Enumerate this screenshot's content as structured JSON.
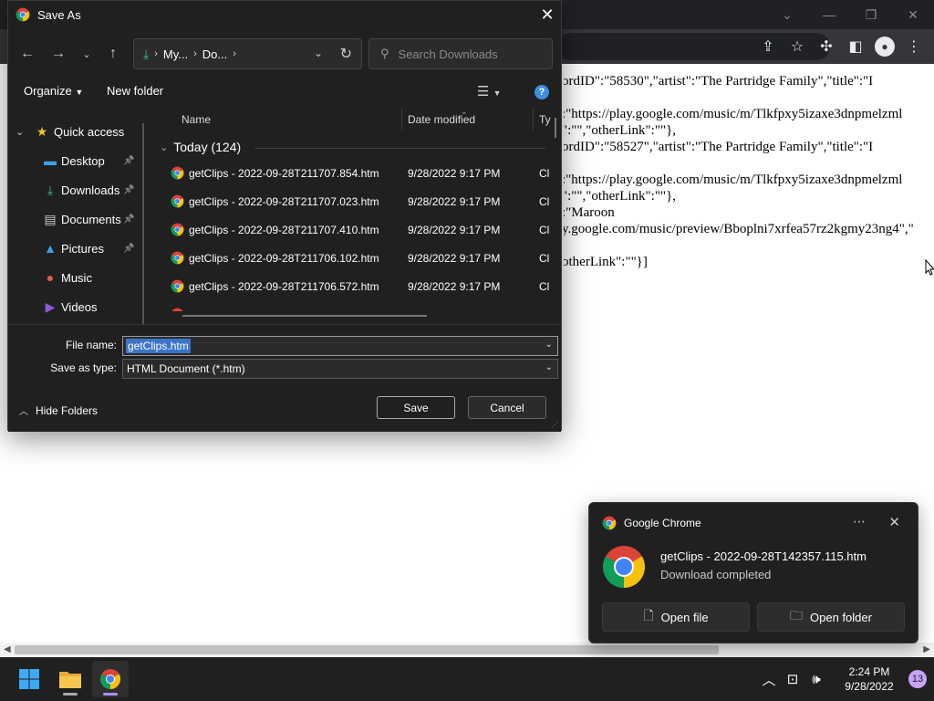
{
  "page": {
    "json_lines": [
      "ordID\":\"58530\",\"artist\":\"The Partridge Family\",\"title\":\"I",
      "",
      ":\"https://play.google.com/music/m/Tlkfpxy5izaxe3dnpmelzml",
      "\":\"\",\"otherLink\":\"\"},",
      "ordID\":\"58527\",\"artist\":\"The Partridge Family\",\"title\":\"I",
      "",
      ":\"https://play.google.com/music/m/Tlkfpxy5izaxe3dnpmelzml",
      "\":\"\",\"otherLink\":\"\"},",
      ":\"Maroon",
      "y.google.com/music/preview/Bboplni7xrfea57rz2kgmy23ng4\",\"",
      "",
      "otherLink\":\"\"}]"
    ]
  },
  "dialog": {
    "title": "Save As",
    "path_segments": [
      "My...",
      "Do..."
    ],
    "search_placeholder": "Search Downloads",
    "organize_label": "Organize",
    "new_folder_label": "New folder",
    "help_label": "?",
    "nav_items": [
      {
        "label": "Quick access",
        "icon": "star-icon",
        "icon_glyph": "★",
        "icon_color": "#f2c12e",
        "pinned": false,
        "quick": true
      },
      {
        "label": "Desktop",
        "icon": "desktop-icon",
        "icon_glyph": "▬",
        "icon_color": "#3aa0e8",
        "pinned": true,
        "quick": false
      },
      {
        "label": "Downloads",
        "icon": "download-icon",
        "icon_glyph": "⤓",
        "icon_color": "#3ec47b",
        "pinned": true,
        "quick": false
      },
      {
        "label": "Documents",
        "icon": "document-icon",
        "icon_glyph": "▤",
        "icon_color": "#c8ccd2",
        "pinned": true,
        "quick": false
      },
      {
        "label": "Pictures",
        "icon": "pictures-icon",
        "icon_glyph": "▲",
        "icon_color": "#3aa0e8",
        "pinned": true,
        "quick": false
      },
      {
        "label": "Music",
        "icon": "music-icon",
        "icon_glyph": "●",
        "icon_color": "#e85c4a",
        "pinned": false,
        "quick": false
      },
      {
        "label": "Videos",
        "icon": "videos-icon",
        "icon_glyph": "▶",
        "icon_color": "#8c5ad8",
        "pinned": false,
        "quick": false
      }
    ],
    "columns": {
      "name": "Name",
      "date": "Date modified",
      "type": "Ty"
    },
    "group_label": "Today (124)",
    "files": [
      {
        "name": "getClips - 2022-09-28T211707.854.htm",
        "date": "9/28/2022 9:17 PM",
        "type": "Cl"
      },
      {
        "name": "getClips - 2022-09-28T211707.023.htm",
        "date": "9/28/2022 9:17 PM",
        "type": "Cl"
      },
      {
        "name": "getClips - 2022-09-28T211707.410.htm",
        "date": "9/28/2022 9:17 PM",
        "type": "Cl"
      },
      {
        "name": "getClips - 2022-09-28T211706.102.htm",
        "date": "9/28/2022 9:17 PM",
        "type": "Cl"
      },
      {
        "name": "getClips - 2022-09-28T211706.572.htm",
        "date": "9/28/2022 9:17 PM",
        "type": "Cl"
      }
    ],
    "file_name_label": "File name:",
    "file_name_value": "getClips.htm",
    "save_type_label": "Save as type:",
    "save_type_value": "HTML Document (*.htm)",
    "hide_folders_label": "Hide Folders",
    "save_button": "Save",
    "cancel_button": "Cancel"
  },
  "toast": {
    "app_name": "Google Chrome",
    "file_name": "getClips - 2022-09-28T142357.115.htm",
    "status": "Download completed",
    "open_file": "Open file",
    "open_folder": "Open folder"
  },
  "taskbar": {
    "time": "2:24 PM",
    "date": "9/28/2022",
    "notifications": "13"
  },
  "colors": {
    "dialog_bg": "#202020",
    "accent": "#3c74c8",
    "chrome_red": "#db4437",
    "chrome_yellow": "#f4c20d",
    "chrome_green": "#0f9d58",
    "chrome_blue": "#4285f4"
  }
}
